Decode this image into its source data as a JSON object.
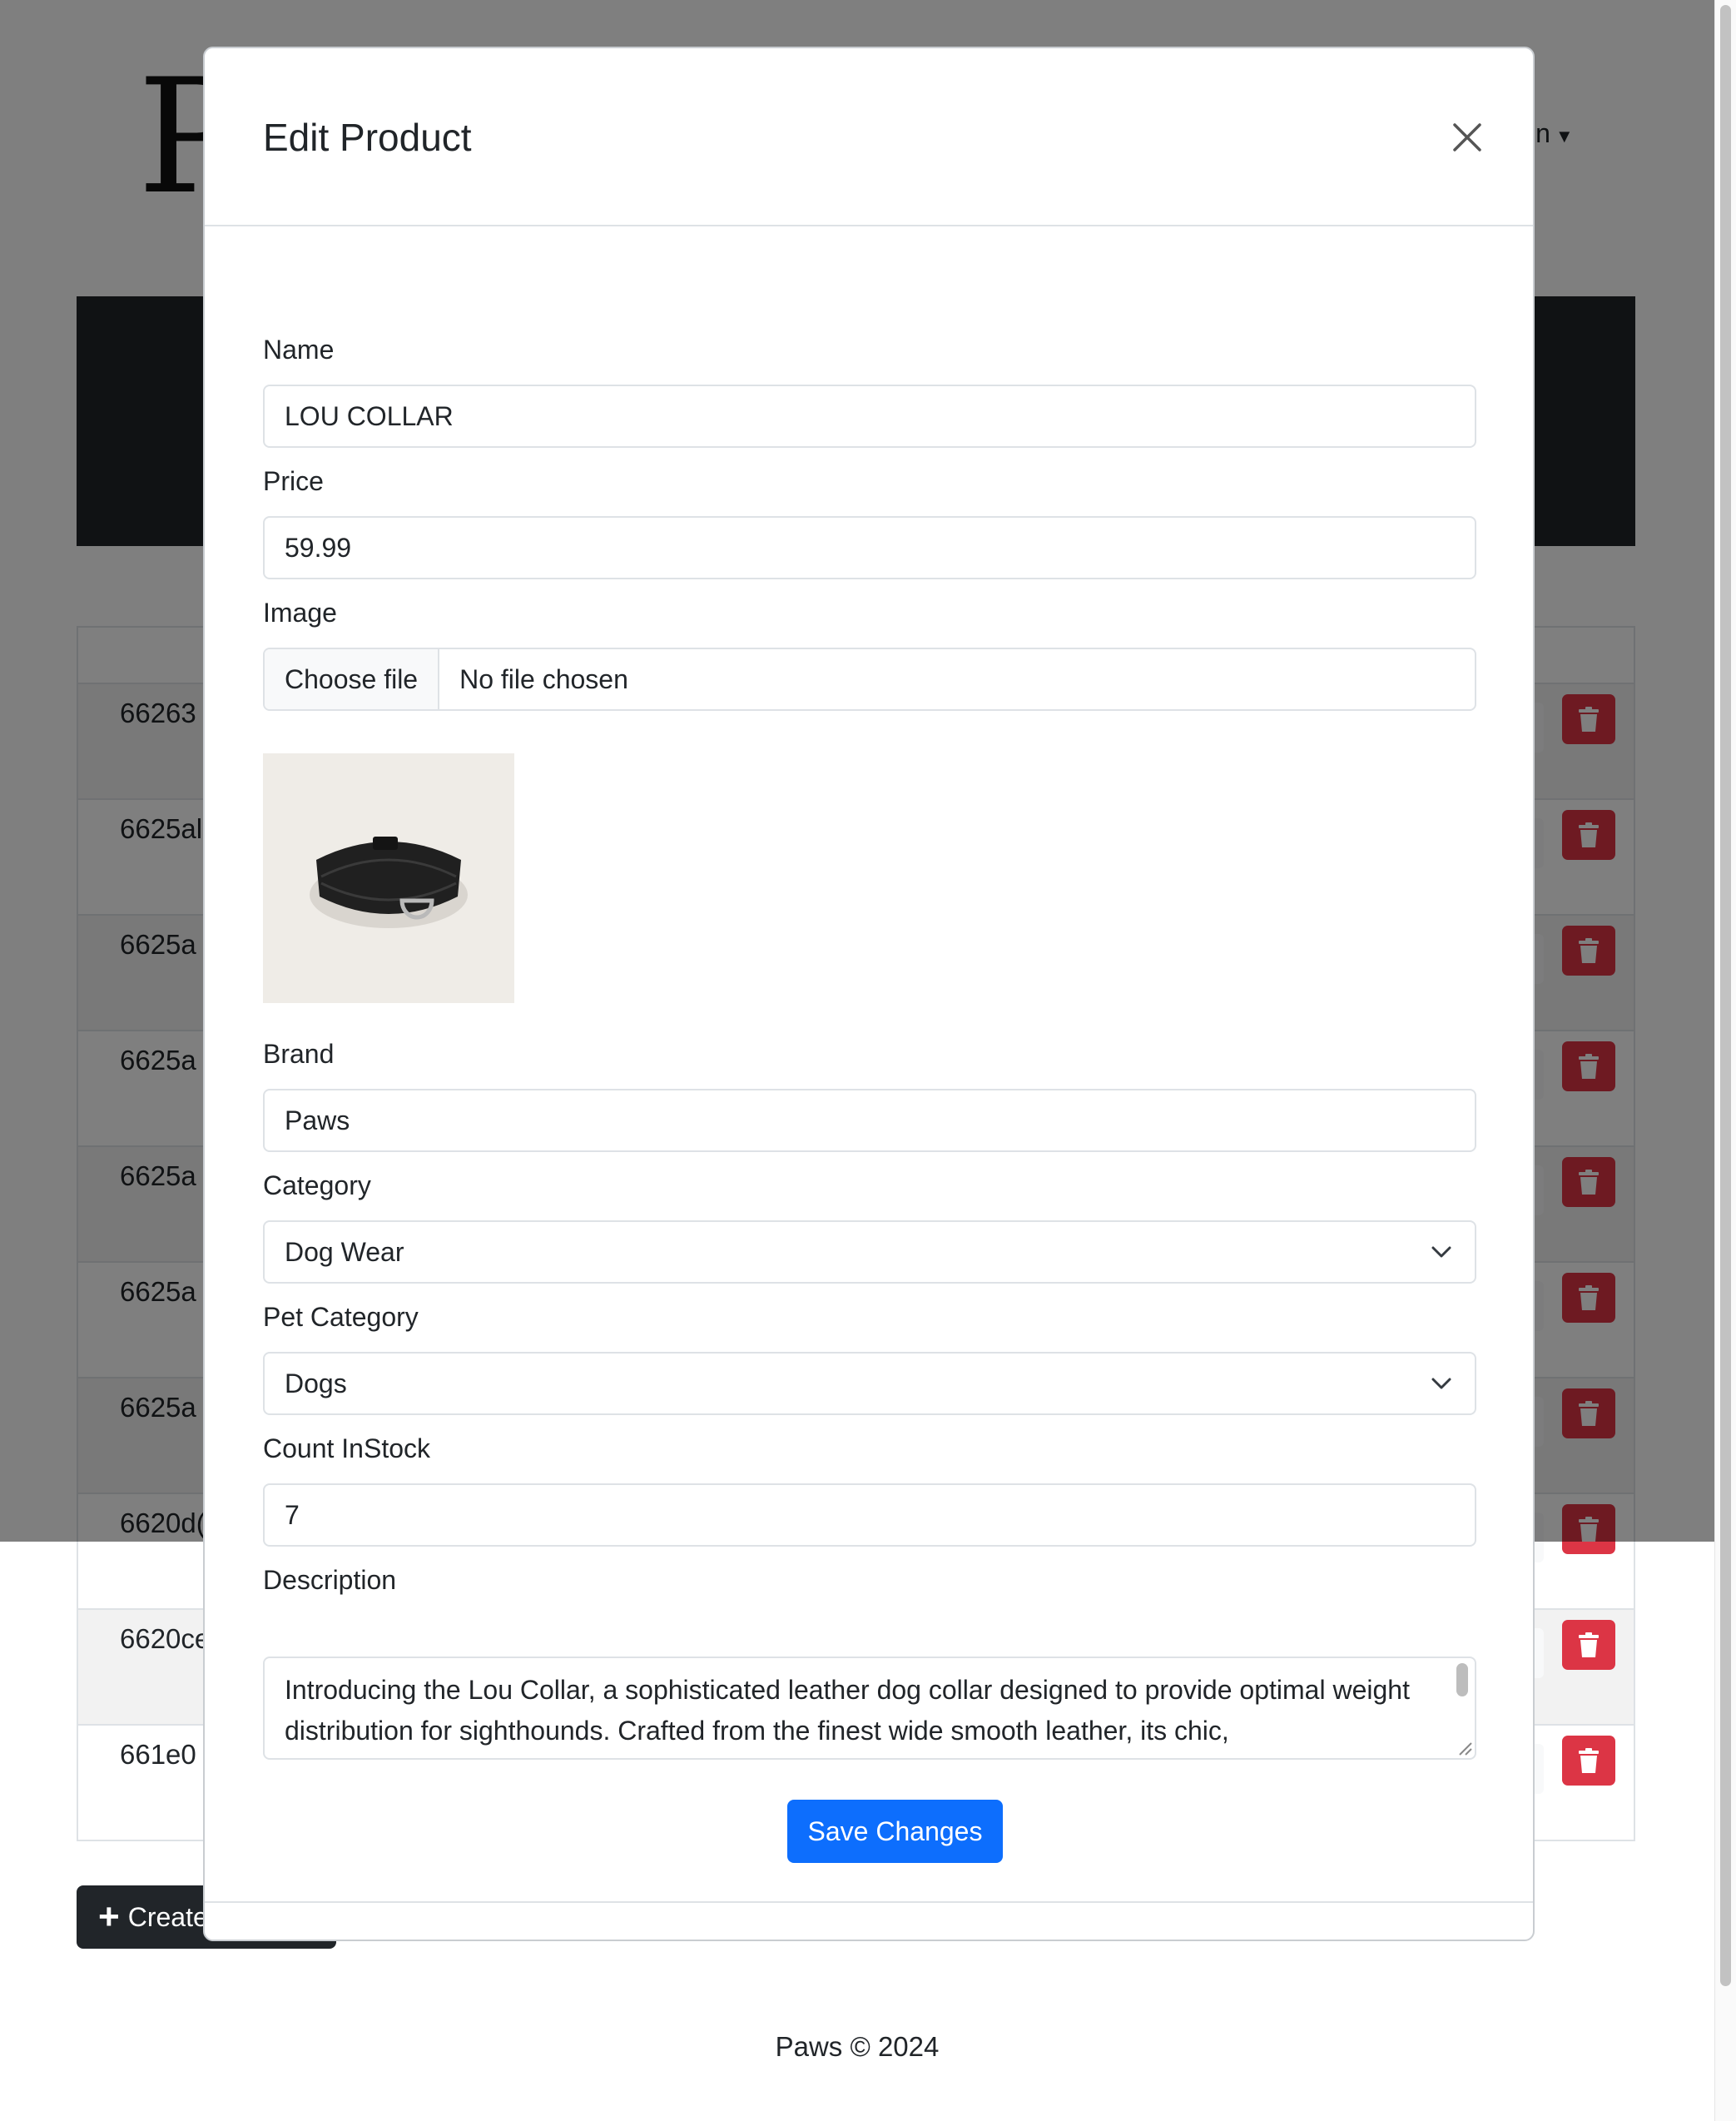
{
  "brand": {
    "logo_text": "Pa",
    "user_menu_label": "in"
  },
  "products_table": {
    "rows": [
      {
        "id": "66263"
      },
      {
        "id": "6625al"
      },
      {
        "id": "6625a"
      },
      {
        "id": "6625a"
      },
      {
        "id": "6625a"
      },
      {
        "id": "6625a"
      },
      {
        "id": "6625a"
      },
      {
        "id": "6620d("
      },
      {
        "id": "6620ce"
      },
      {
        "id": "661e0"
      }
    ]
  },
  "create_button": {
    "label": "Create"
  },
  "footer": {
    "text": "Paws © 2024"
  },
  "modal": {
    "title": "Edit Product",
    "fields": {
      "name": {
        "label": "Name",
        "value": "LOU COLLAR"
      },
      "price": {
        "label": "Price",
        "value": "59.99"
      },
      "image": {
        "label": "Image",
        "button_label": "Choose file",
        "status": "No file chosen"
      },
      "brand": {
        "label": "Brand",
        "value": "Paws"
      },
      "category": {
        "label": "Category",
        "value": "Dog Wear"
      },
      "pet_category": {
        "label": "Pet Category",
        "value": "Dogs"
      },
      "count_in_stock": {
        "label": "Count InStock",
        "value": "7"
      },
      "description": {
        "label": "Description",
        "value": "Introducing the Lou Collar, a sophisticated leather dog collar designed to provide optimal weight distribution for sighthounds. Crafted from the finest wide smooth leather, its chic,"
      }
    },
    "save_label": "Save Changes"
  },
  "colors": {
    "primary": "#0d6efd",
    "danger": "#dc3545",
    "dark": "#212529"
  }
}
